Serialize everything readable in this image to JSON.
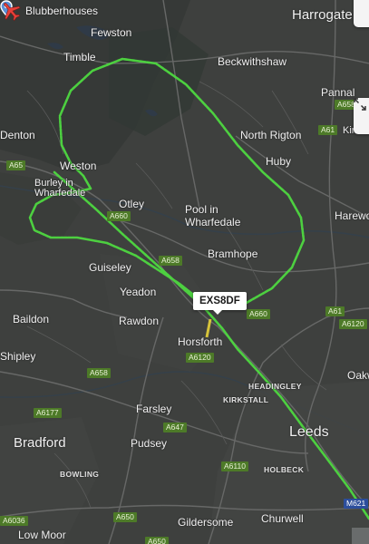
{
  "map": {
    "places": [
      {
        "id": "blubberhouses",
        "name": "Blubberhouses"
      },
      {
        "id": "harrogate",
        "name": "Harrogate"
      },
      {
        "id": "fewston",
        "name": "Fewston"
      },
      {
        "id": "timble",
        "name": "Timble"
      },
      {
        "id": "beckwithshaw",
        "name": "Beckwithshaw"
      },
      {
        "id": "pannal",
        "name": "Pannal"
      },
      {
        "id": "denton",
        "name": "Denton"
      },
      {
        "id": "north-rigton",
        "name": "North Rigton"
      },
      {
        "id": "kirkby-overblow",
        "name": "Kirk Overb"
      },
      {
        "id": "weston",
        "name": "Weston"
      },
      {
        "id": "huby",
        "name": "Huby"
      },
      {
        "id": "burley-in-wharfedale",
        "name": "Burley in\nWharfedale"
      },
      {
        "id": "otley",
        "name": "Otley"
      },
      {
        "id": "pool-in-wharfedale",
        "name": "Pool in\nWharfedale"
      },
      {
        "id": "harewood",
        "name": "Harewo"
      },
      {
        "id": "bramhope",
        "name": "Bramhope"
      },
      {
        "id": "guiseley",
        "name": "Guiseley"
      },
      {
        "id": "yeadon",
        "name": "Yeadon"
      },
      {
        "id": "baildon",
        "name": "Baildon"
      },
      {
        "id": "rawdon",
        "name": "Rawdon"
      },
      {
        "id": "horsforth",
        "name": "Horsforth"
      },
      {
        "id": "shipley",
        "name": "Shipley"
      },
      {
        "id": "headingley",
        "name": "HEADINGLEY"
      },
      {
        "id": "oakwood",
        "name": "Oakw"
      },
      {
        "id": "kirkstall",
        "name": "KIRKSTALL"
      },
      {
        "id": "farsley",
        "name": "Farsley"
      },
      {
        "id": "leeds",
        "name": "Leeds"
      },
      {
        "id": "bradford",
        "name": "Bradford"
      },
      {
        "id": "pudsey",
        "name": "Pudsey"
      },
      {
        "id": "bowling",
        "name": "BOWLING"
      },
      {
        "id": "holbeck",
        "name": "HOLBECK"
      },
      {
        "id": "gildersome",
        "name": "Gildersome"
      },
      {
        "id": "churwell",
        "name": "Churwell"
      },
      {
        "id": "low-moor",
        "name": "Low Moor"
      }
    ],
    "roads": [
      {
        "id": "a658-top",
        "ref": "A658"
      },
      {
        "id": "a61-top",
        "ref": "A61"
      },
      {
        "id": "a65",
        "ref": "A65"
      },
      {
        "id": "a660-otley",
        "ref": "A660"
      },
      {
        "id": "a658-bramhope",
        "ref": "A658"
      },
      {
        "id": "a660-lawnswood",
        "ref": "A660"
      },
      {
        "id": "a61-mid",
        "ref": "A61"
      },
      {
        "id": "a6120-east",
        "ref": "A6120"
      },
      {
        "id": "a6120-horsforth",
        "ref": "A6120"
      },
      {
        "id": "a658-south",
        "ref": "A658"
      },
      {
        "id": "a6177",
        "ref": "A6177"
      },
      {
        "id": "a647",
        "ref": "A647"
      },
      {
        "id": "a6110",
        "ref": "A6110"
      },
      {
        "id": "a6036",
        "ref": "A6036"
      },
      {
        "id": "a650-a",
        "ref": "A650"
      },
      {
        "id": "a650-b",
        "ref": "A650"
      },
      {
        "id": "m621",
        "ref": "M621"
      }
    ],
    "flight": {
      "callsign": "EXS8DF",
      "track_color": "#4ed840",
      "plane_color": "#e8403a"
    }
  }
}
